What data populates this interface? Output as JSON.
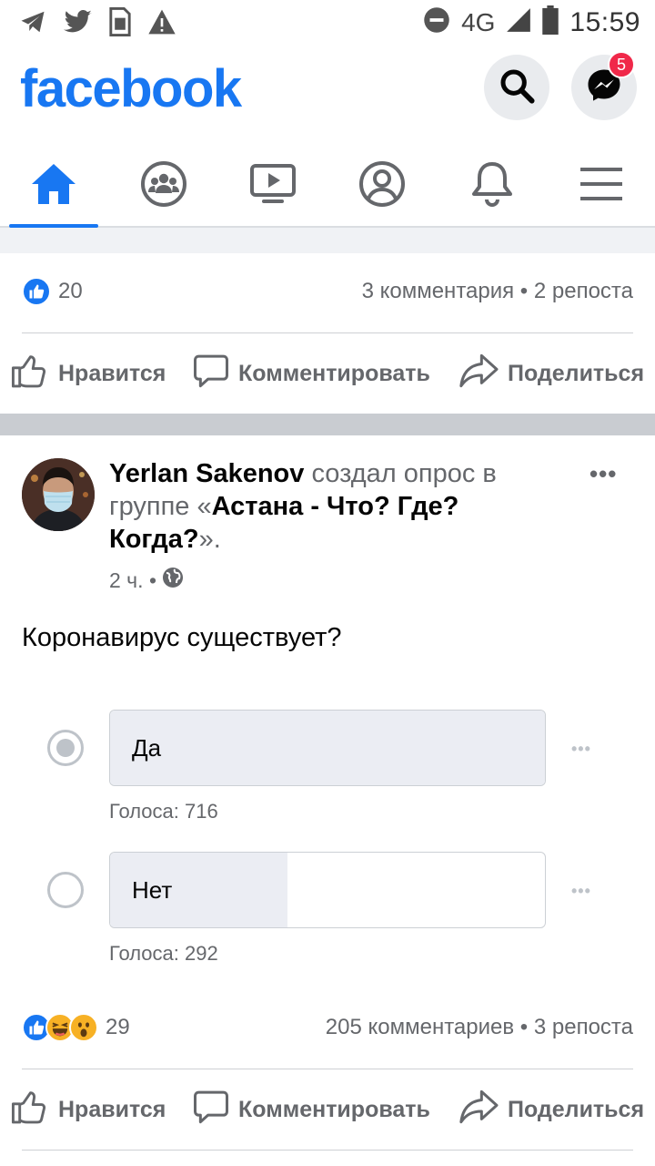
{
  "status_bar": {
    "network": "4G",
    "time": "15:59"
  },
  "header": {
    "logo": "facebook",
    "messenger_badge": "5"
  },
  "nav_tabs": [
    "home",
    "groups",
    "watch",
    "profile",
    "notifications",
    "menu"
  ],
  "prev_post": {
    "like_count": "20",
    "stats": "3 комментария • 2 репоста"
  },
  "actions": {
    "like": "Нравится",
    "comment": "Комментировать",
    "share": "Поделиться"
  },
  "post": {
    "author": "Yerlan Sakenov",
    "action_text": " создал опрос в группе «",
    "group": "Астана - Что? Где? Когда?",
    "suffix": "».",
    "time": "2 ч. •",
    "question": "Коронавирус существует?",
    "poll": [
      {
        "label": "Да",
        "votes_text": "Голоса: 716",
        "selected": true,
        "fill_fraction": 1.0
      },
      {
        "label": "Нет",
        "votes_text": "Голоса: 292",
        "selected": false,
        "fill_fraction": 0.408
      }
    ],
    "reaction_count": "29",
    "stats": "205 комментариев • 3 репоста"
  },
  "colors": {
    "brand": "#1877f2",
    "badge": "#f02849",
    "secondary_text": "#65676b"
  }
}
